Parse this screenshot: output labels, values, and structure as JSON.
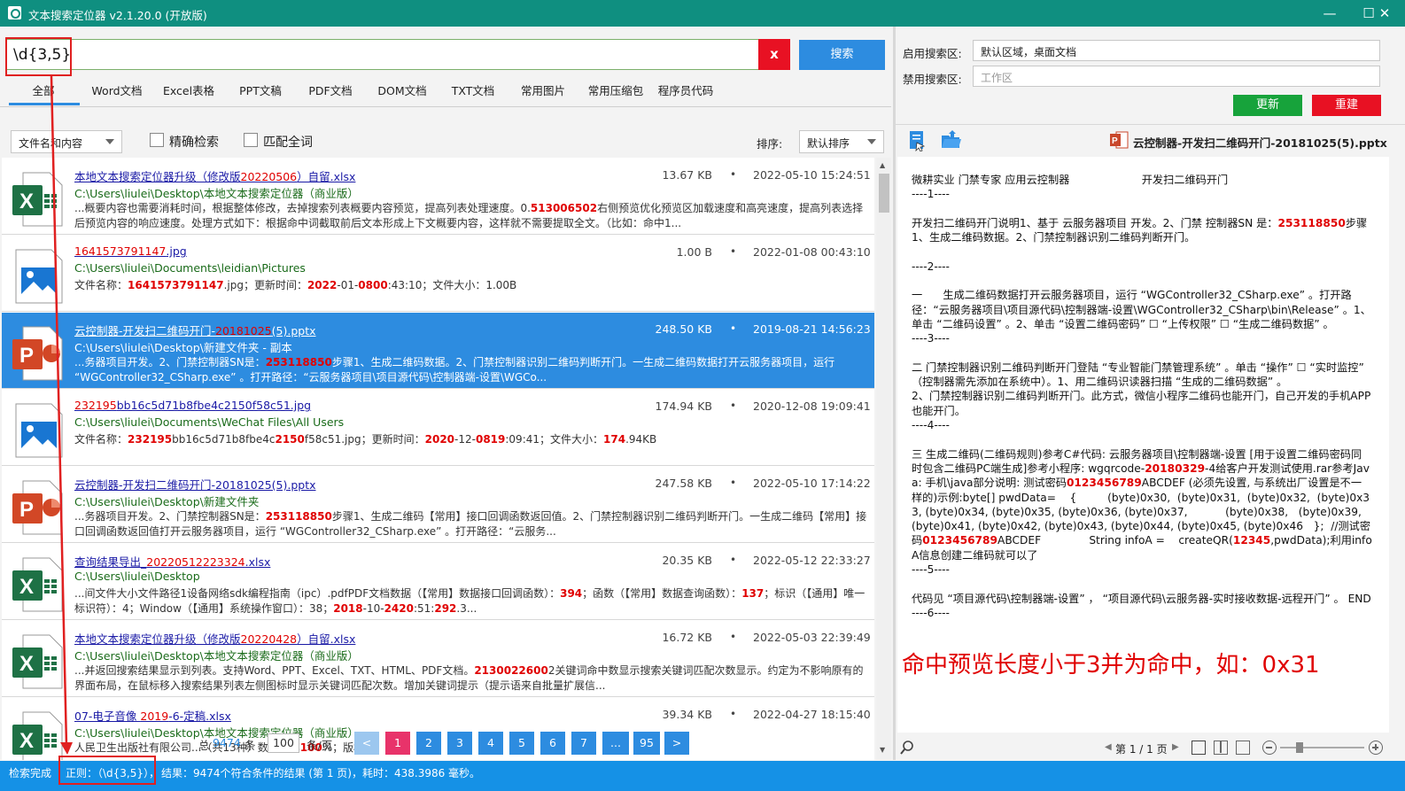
{
  "window": {
    "title": "文本搜索定位器 v2.1.20.0 (开放版)",
    "min": "—",
    "max": "☐",
    "close": "✕"
  },
  "search": {
    "value": "\\d{3,5}",
    "clear": "x",
    "button": "搜索"
  },
  "tabs": [
    "全部",
    "Word文档",
    "Excel表格",
    "PPT文稿",
    "PDF文档",
    "DOM文档",
    "TXT文档",
    "常用图片",
    "常用压缩包",
    "程序员代码"
  ],
  "filters": {
    "scope": "文件名和内容",
    "exact": "精确检索",
    "whole": "匹配全词",
    "sort_label": "排序:",
    "sort_value": "默认排序"
  },
  "right": {
    "enable_label": "启用搜索区:",
    "enable_value": "默认区域，桌面文档",
    "disable_label": "禁用搜索区:",
    "disable_placeholder": "工作区",
    "update": "更新",
    "rebuild": "重建",
    "preview_file": "云控制器-开发扫二维码开门-20181025(5).pptx"
  },
  "results": [
    {
      "type": "excel",
      "name_pre": "本地文本搜索定位器升级（修改版",
      "name_hit": "20220506",
      "name_post": "）自留.xlsx",
      "path": "C:\\Users\\liulei\\Desktop\\本地文本搜索定位器（商业版）",
      "size": "13.67 KB",
      "date": "2022-05-10 15:24:51",
      "snippet": [
        "...概要内容也需要消耗时间，根据整体修改，去掉搜索列表概要内容预览，提高列表处理速度。0.",
        {
          "h": "513006502"
        },
        "右侧预览优化预览区加载速度和高亮速度，提高列表选择后预览内容的响应速度。处理方式如下：根据命中词截取前后文本形成上下文概要内容，这样就不需要提取全文。（比如：命中1..."
      ]
    },
    {
      "type": "image",
      "name_pre": "",
      "name_hit": "1641573791147",
      "name_post": ".jpg",
      "path": "C:\\Users\\liulei\\Documents\\leidian\\Pictures",
      "size": "1.00 B",
      "date": "2022-01-08 00:43:10",
      "snippet": [
        "文件名称：",
        {
          "h": "1641573791147"
        },
        ".jpg；更新时间：",
        {
          "h": "2022"
        },
        "-01-",
        {
          "h": "0800"
        },
        ":43:10；文件大小：1.00B"
      ]
    },
    {
      "type": "ppt",
      "selected": true,
      "name_pre": "云控制器-开发扫二维码开门-",
      "name_hit": "20181025",
      "name_post": "(5).pptx",
      "path": "C:\\Users\\liulei\\Desktop\\新建文件夹 - 副本",
      "size": "248.50 KB",
      "date": "2019-08-21 14:56:23",
      "snippet": [
        "...务器项目开发。2、门禁控制器SN是：",
        {
          "h": "253118850"
        },
        "步骤1、生成二维码数据。2、门禁控制器识别二维码判断开门。一生成二维码数据打开云服务器项目，运行 “WGController32_CSharp.exe” 。打开路径：“云服务器项目\\项目源代码\\控制器端-设置\\WGCo..."
      ]
    },
    {
      "type": "image",
      "name_pre": "",
      "name_hit": "232195",
      "name_post": "bb16c5d71b8fbe4c2150f58c51.jpg",
      "path": "C:\\Users\\liulei\\Documents\\WeChat Files\\All Users",
      "size": "174.94 KB",
      "date": "2020-12-08 19:09:41",
      "snippet": [
        "文件名称：",
        {
          "h": "232195"
        },
        "bb16c5d71b8fbe4c",
        {
          "h": "2150"
        },
        "f58c51.jpg；更新时间：",
        {
          "h": "2020"
        },
        "-12-",
        {
          "h": "0819"
        },
        ":09:41；文件大小：",
        {
          "h": "174"
        },
        ".94KB"
      ]
    },
    {
      "type": "ppt",
      "name_pre": "云控制器-开发扫二维码开门-20181025(5).pptx",
      "name_hit": "",
      "name_post": "",
      "path": "C:\\Users\\liulei\\Desktop\\新建文件夹",
      "size": "247.58 KB",
      "date": "2022-05-10 17:14:22",
      "snippet": [
        "...务器项目开发。2、门禁控制器SN是：",
        {
          "h": "253118850"
        },
        "步骤1、生成二维码【常用】接口回调函数返回值。2、门禁控制器识别二维码判断开门。一生成二维码【常用】接口回调函数返回值打开云服务器项目，运行 “WGController32_CSharp.exe” 。打开路径：“云服务..."
      ]
    },
    {
      "type": "excel",
      "name_pre": "查询结果导出_",
      "name_hit": "20220512223324",
      "name_post": ".xlsx",
      "path": "C:\\Users\\liulei\\Desktop",
      "size": "20.35 KB",
      "date": "2022-05-12 22:33:27",
      "snippet": [
        "...间文件大小文件路径1设备网络sdk编程指南（ipc）.pdfPDF文档数据（【常用】数据接口回调函数）：",
        {
          "h": "394"
        },
        "；函数（【常用】数据查询函数）：",
        {
          "h": "137"
        },
        "；标识（【通用】唯一标识符）：4；Window（【通用】系统操作窗口）：38；",
        {
          "h": "2018"
        },
        "-10-",
        {
          "h": "2420"
        },
        ":51:",
        {
          "h": "292"
        },
        ".3..."
      ]
    },
    {
      "type": "excel",
      "name_pre": "本地文本搜索定位器升级（修改版",
      "name_hit": "20220428",
      "name_post": "）自留.xlsx",
      "path": "C:\\Users\\liulei\\Desktop\\本地文本搜索定位器（商业版）",
      "size": "16.72 KB",
      "date": "2022-05-03 22:39:49",
      "snippet": [
        "...并返回搜索结果显示到列表。支持Word、PPT、Excel、TXT、HTML、PDF文档。",
        {
          "h": "2130022600"
        },
        "2关键词命中数显示搜索关键词匹配次数显示。约定为不影响原有的界面布局，在鼠标移入搜索结果列表左侧图标时显示关键词匹配次数。增加关键词提示（提示语来自批量扩展信..."
      ]
    },
    {
      "type": "excel",
      "name_pre": "07-电子音像 ",
      "name_hit": "2019",
      "name_post": "-6-定稿.xlsx",
      "path": "C:\\Users\\liulei\\Desktop\\本地文本搜索定位器（商业版）",
      "size": "39.34 KB",
      "date": "2022-04-27 18:15:40",
      "snippet": [
        "人民卫生出版社有限公司...（共13种）数字化率",
        {
          "h": "100"
        },
        "%；版权开"
      ]
    }
  ],
  "pager": {
    "total_pre": "总",
    "total": "9474",
    "total_post": "条",
    "per_page": "100",
    "per_label": "条/页",
    "prev": "<",
    "pages": [
      "1",
      "2",
      "3",
      "4",
      "5",
      "6",
      "7",
      "...",
      "95"
    ],
    "next": ">"
  },
  "status": {
    "done": "检索完成",
    "regex": "正则：（\\d{3,5}），",
    "result": "结果：9474个符合条件的结果 (第 1 页)，耗时：438.3986 毫秒。"
  },
  "preview": {
    "text": [
      "微耕实业 门禁专家 应用云控制器                     开发扫二维码开门\n----1----\n\n开发扫二维码开门说明1、基于 云服务器项目 开发。2、门禁 控制器SN 是：",
      {
        "h": "253118850"
      },
      "步骤1、生成二维码数据。2、门禁控制器识别二维码判断开门。\n\n----2----\n\n一      生成二维码数据打开云服务器项目，运行 “WGController32_CSharp.exe” 。打开路径：“云服务器项目\\项目源代码\\控制器端-设置\\WGController32_CSharp\\bin\\Release” 。1、单击 “二维码设置” 。2、单击 “设置二维码密码” ☐ “上传权限” ☐ “生成二维码数据” 。\n----3----\n\n二 门禁控制器识别二维码判断开门登陆 “专业智能门禁管理系统” 。单击 “操作” ☐ “实时监控” （控制器需先添加在系统中）。1、用二维码识读器扫描 “生成的二维码数据” 。\n2、门禁控制器识别二维码判断开门。此方式，微信小程序二维码也能开门，自己开发的手机APP也能开门。\n----4----\n\n三 生成二维码(二维码规则)参考C#代码: 云服务器项目\\控制器端-设置 [用于设置二维码密码同时包含二维码PC端生成]参考小程序: wgqrcode-",
      {
        "h": "20180329"
      },
      "-4给客户开发测试使用.rar参考Java: 手机\\java部分说明: 测试密码",
      {
        "h": "0123456789"
      },
      "ABCDEF (必须先设置, 与系统出厂设置是不一样的)示例:byte[] pwdData=    {         (byte)0x30,  (byte)0x31,  (byte)0x32,  (byte)0x33, (byte)0x34, (byte)0x35, (byte)0x36, (byte)0x37,           (byte)0x38,   (byte)0x39, (byte)0x41, (byte)0x42, (byte)0x43, (byte)0x44, (byte)0x45, (byte)0x46   };  //测试密码",
      {
        "h": "0123456789"
      },
      "ABCDEF              String infoA =    createQR(",
      {
        "h": "12345"
      },
      ",pwdData);利用infoA信息创建二维码就可以了\n----5----\n\n代码见 “项目源代码\\控制器端-设置” ， “项目源代码\\云服务器-实时接收数据-远程开门” 。 END\n----6----"
    ]
  },
  "annotation": "命中预览长度小于3并为命中，如：0x31",
  "viewer": {
    "page": "第 1 / 1 页"
  },
  "colors": {
    "accent": "#2d8ce0",
    "titlebar": "#0f8f80",
    "highlight": "#e00000",
    "selected_row": "#2d8ce0",
    "status": "#1591e6"
  },
  "icons": {
    "doc": "file-list-icon",
    "open": "folder-open-icon",
    "search": "magnifier-icon",
    "zoom_out": "zoom-out-icon",
    "zoom_in": "zoom-in-icon"
  }
}
